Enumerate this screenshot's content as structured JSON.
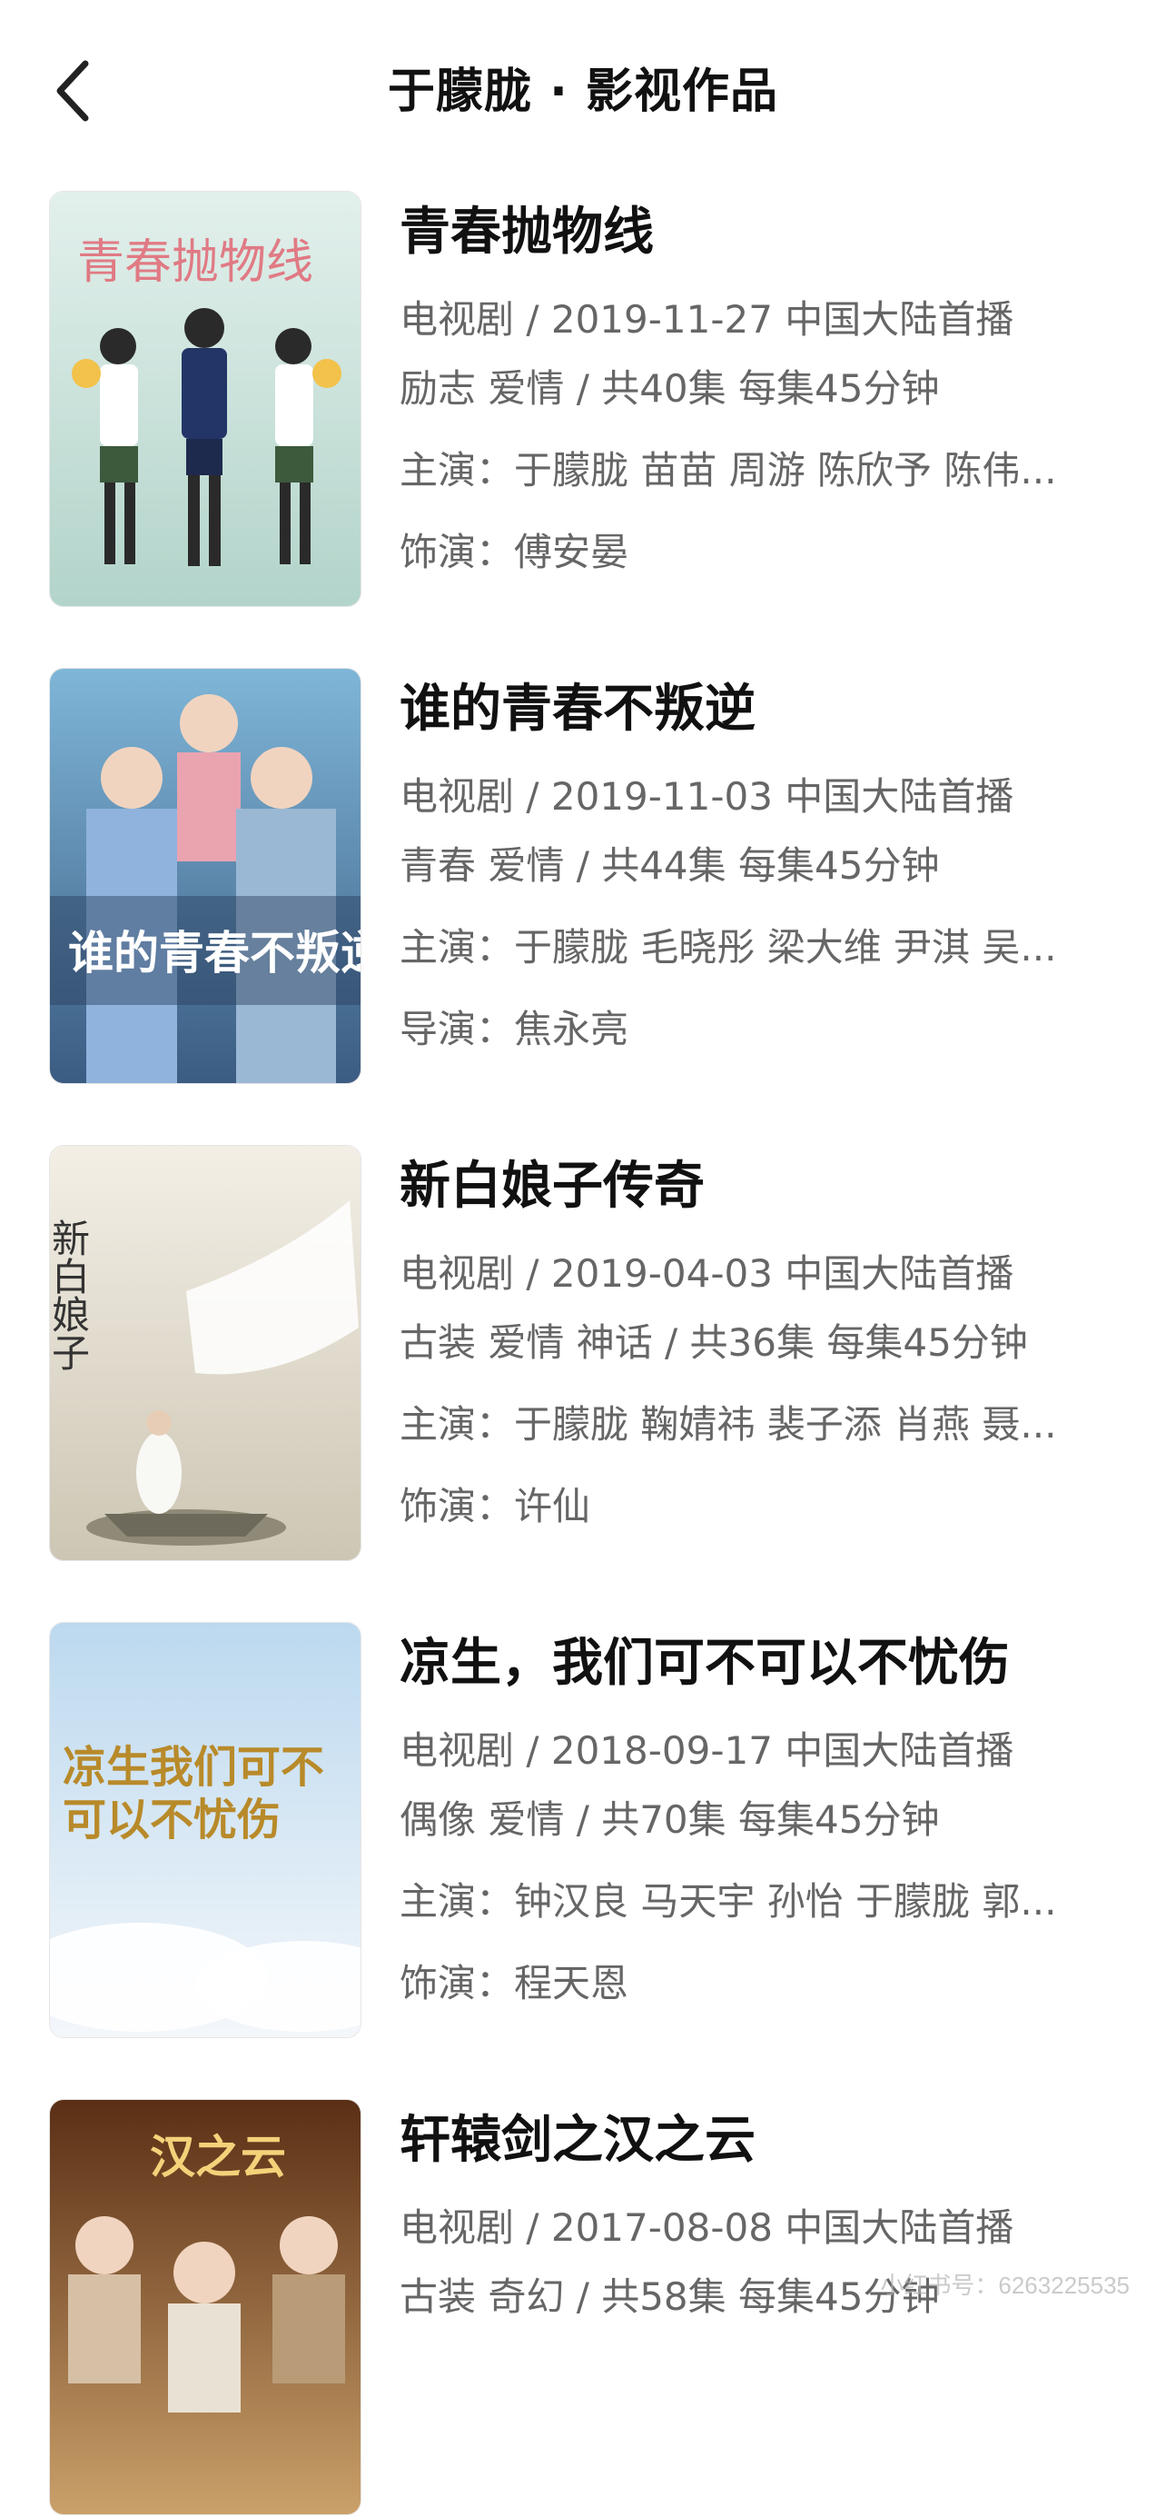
{
  "header": {
    "title": "于朦胧 · 影视作品"
  },
  "works": [
    {
      "title": "青春抛物线",
      "release": "电视剧 / 2019-11-27 中国大陆首播",
      "genre": "励志 爱情 / 共40集 每集45分钟",
      "cast": "主演：于朦胧 苗苗 周游 陈欣予 陈伟...",
      "role": "饰演：傅安晏",
      "poster_text": "青春抛物线",
      "poster_colors": [
        "#dfeee9",
        "#a9cfc4"
      ]
    },
    {
      "title": "谁的青春不叛逆",
      "release": "电视剧 / 2019-11-03 中国大陆首播",
      "genre": "青春 爱情 / 共44集 每集45分钟",
      "cast": "主演：于朦胧 毛晓彤 梁大维 尹淇 吴...",
      "role": "导演：焦永亮",
      "poster_text": "谁的青春不叛逆",
      "poster_colors": [
        "#6a9ec9",
        "#3f5f86"
      ]
    },
    {
      "title": "新白娘子传奇",
      "release": "电视剧 / 2019-04-03 中国大陆首播",
      "genre": "古装 爱情 神话 / 共36集 每集45分钟",
      "cast": "主演：于朦胧 鞠婧祎 裴子添 肖燕 聂...",
      "role": "饰演：许仙",
      "poster_text": "新白娘子",
      "poster_colors": [
        "#efeadf",
        "#cfc8b7"
      ]
    },
    {
      "title": "凉生，我们可不可以不忧伤",
      "release": "电视剧 / 2018-09-17 中国大陆首播",
      "genre": "偶像 爱情 / 共70集 每集45分钟",
      "cast": "主演：钟汉良 马天宇 孙怡 于朦胧 郭...",
      "role": "饰演：程天恩",
      "poster_text": "凉生我们可不可以不忧伤",
      "poster_colors": [
        "#cfe4f4",
        "#f2f6fa"
      ]
    },
    {
      "title": "轩辕剑之汉之云",
      "release": "电视剧 / 2017-08-08 中国大陆首播",
      "genre": "古装 奇幻 / 共58集 每集45分钟",
      "cast": "",
      "role": "",
      "poster_text": "汉之云",
      "poster_colors": [
        "#6b3b1e",
        "#d9a45c"
      ]
    }
  ],
  "watermark": "小红书号：6263225535",
  "icons": {
    "back": "chevron-left-icon"
  }
}
